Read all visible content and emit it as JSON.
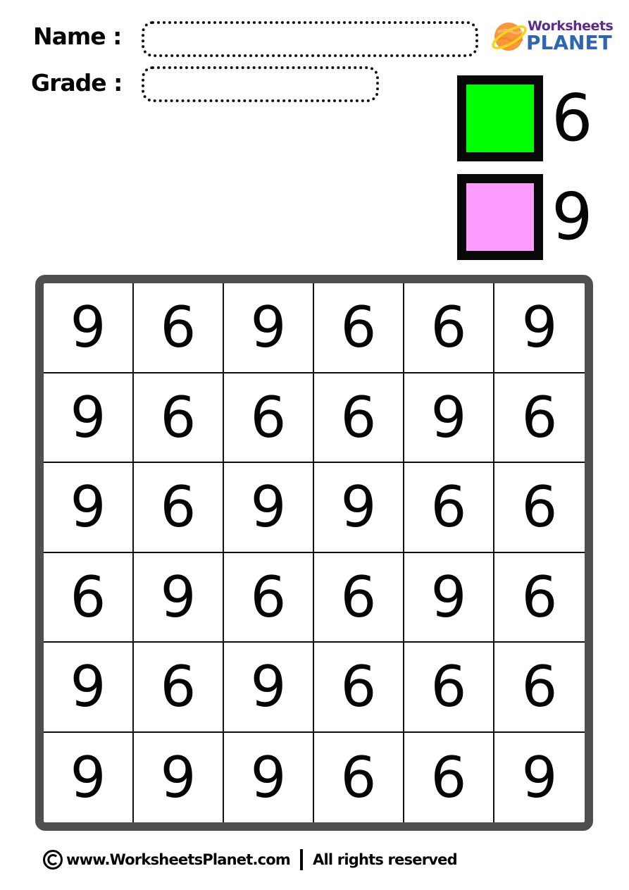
{
  "header": {
    "name_label": "Name :",
    "grade_label": "Grade :",
    "name_value": "",
    "grade_value": ""
  },
  "logo": {
    "word1": "Worksheets",
    "word2": "PLANET",
    "icon": "planet-icon",
    "colors": {
      "word1": "#5b2b8e",
      "word2": "#2f66b3",
      "planet": "#f7963b",
      "ring": "#f5d21b"
    }
  },
  "legend": [
    {
      "digit": "6",
      "color": "#00ff00",
      "color_name": "green"
    },
    {
      "digit": "9",
      "color": "#ff9cff",
      "color_name": "pink"
    }
  ],
  "grid": {
    "rows": [
      [
        "9",
        "6",
        "9",
        "6",
        "6",
        "9"
      ],
      [
        "9",
        "6",
        "6",
        "6",
        "9",
        "6"
      ],
      [
        "9",
        "6",
        "9",
        "9",
        "6",
        "6"
      ],
      [
        "6",
        "9",
        "6",
        "6",
        "9",
        "6"
      ],
      [
        "9",
        "6",
        "9",
        "6",
        "6",
        "6"
      ],
      [
        "9",
        "9",
        "9",
        "6",
        "6",
        "9"
      ]
    ],
    "frame_color": "#4f4f4f"
  },
  "footer": {
    "icon": "copyright-icon",
    "site": "www.WorksheetsPlanet.com",
    "separator": "|",
    "rights": "All rights reserved"
  }
}
